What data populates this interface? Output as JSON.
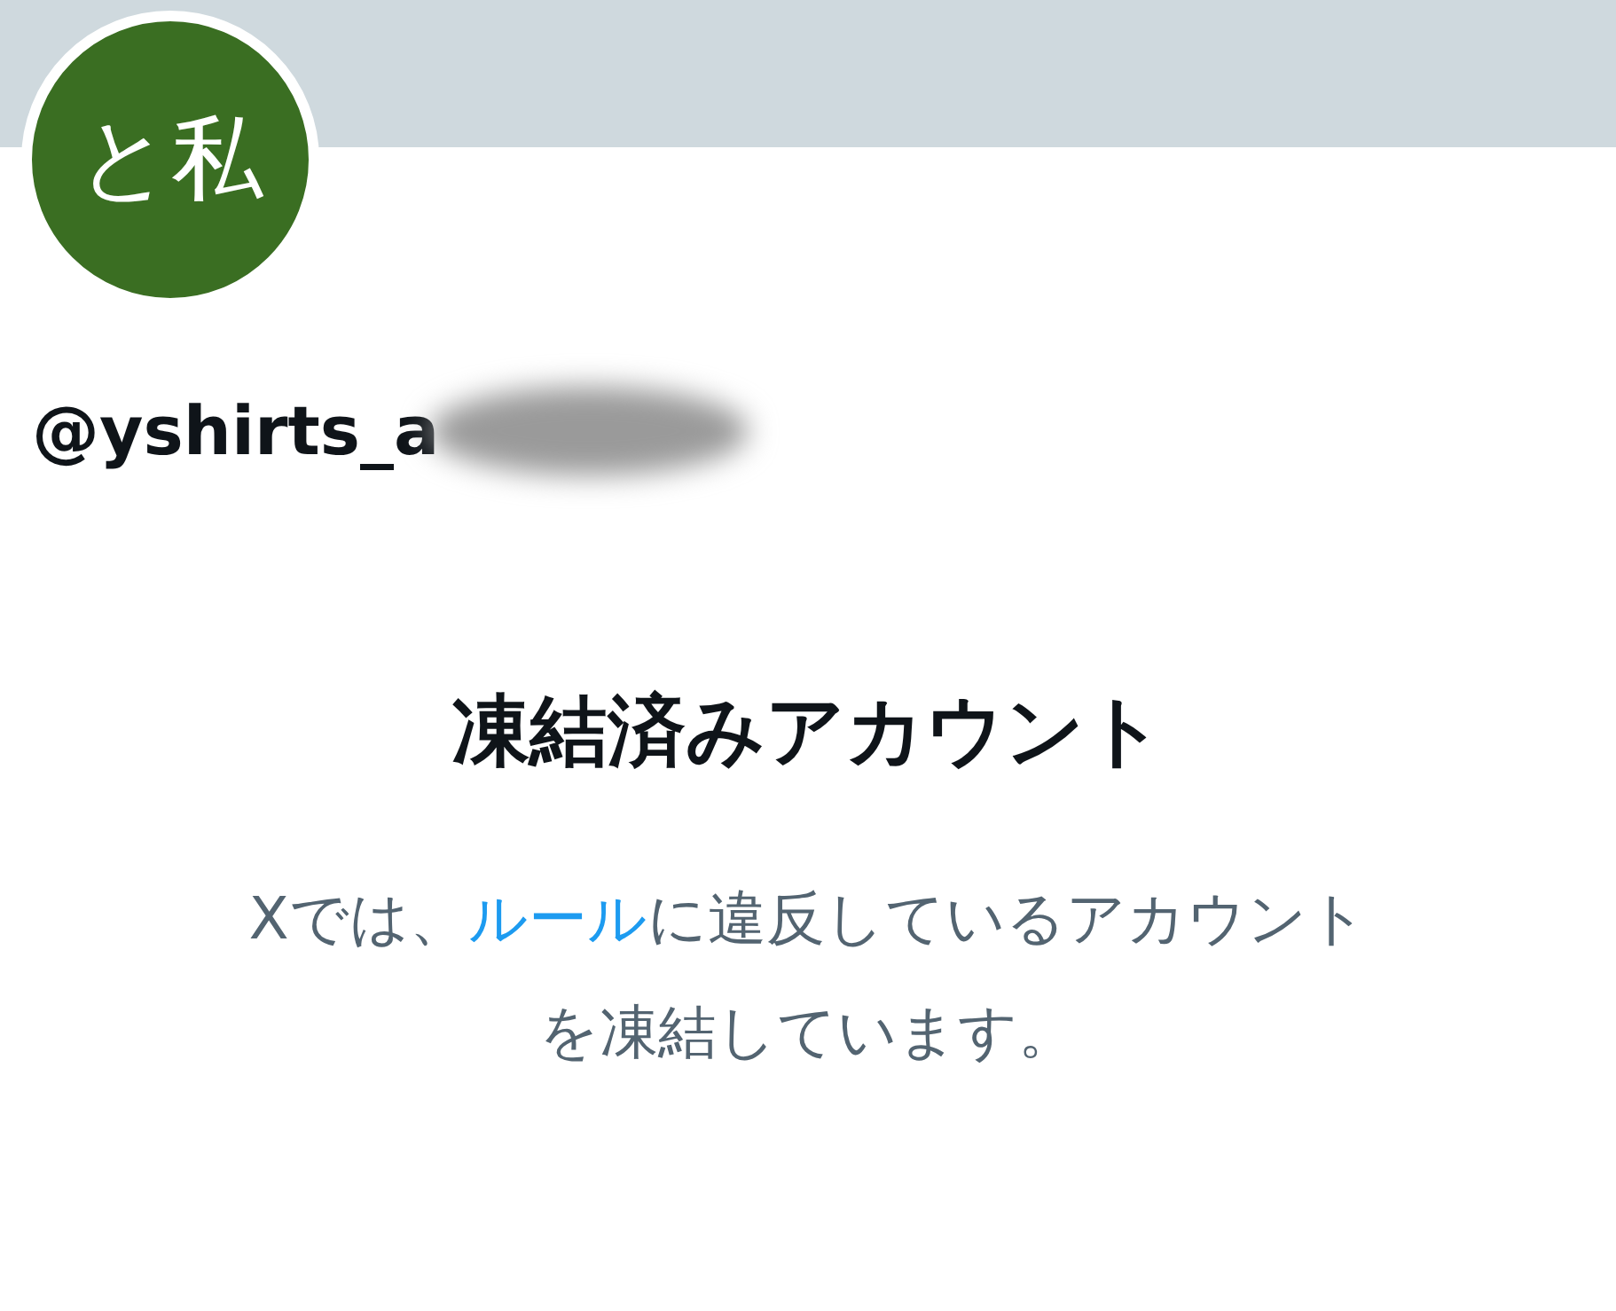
{
  "profile": {
    "avatar_text": "と私",
    "handle": "@yshirts_a",
    "handle_redacted": true
  },
  "notice": {
    "title": "凍結済みアカウント",
    "lines": [
      [
        {
          "kind": "plain",
          "text": "Xでは、"
        },
        {
          "kind": "link",
          "text": "ルール"
        },
        {
          "kind": "plain",
          "text": "に違反しているアカウント"
        }
      ],
      [
        {
          "kind": "plain",
          "text": "を凍結しています。"
        }
      ]
    ]
  }
}
